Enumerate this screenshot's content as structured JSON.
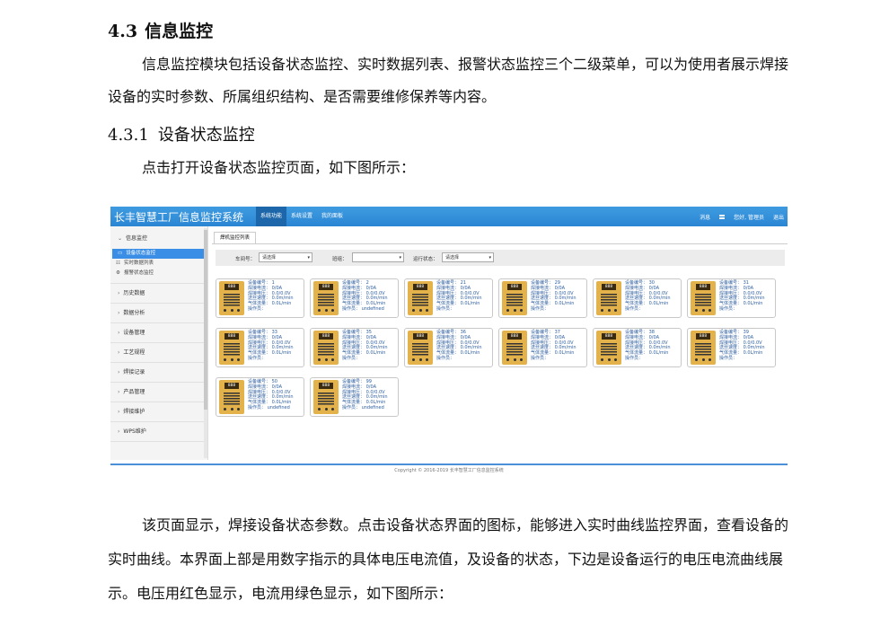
{
  "doc": {
    "section_number": "4.3",
    "section_title": "信息监控",
    "intro_paragraph": "信息监控模块包括设备状态监控、实时数据列表、报警状态监控三个二级菜单，可以为使用者展示焊接设备的实时参数、所属组织结构、是否需要维修保养等内容。",
    "subsection_number": "4.3.1",
    "subsection_title": "设备状态监控",
    "open_paragraph": "点击打开设备状态监控页面，如下图所示：",
    "closing_paragraph": "该页面显示，焊接设备状态参数。点击设备状态界面的图标，能够进入实时曲线监控界面，查看设备的实时曲线。本界面上部是用数字指示的具体电压电流值，及设备的状态，下边是设备运行的电压电流曲线展示。电压用红色显示，电流用绿色显示，如下图所示："
  },
  "app": {
    "title": "长丰智慧工厂信息监控系统",
    "nav": [
      "系统功能",
      "系统设置",
      "我的面板"
    ],
    "right": {
      "messages": "消息",
      "user": "您好, 管理员",
      "logout": "退出"
    },
    "sidebar": {
      "expanded": {
        "label": "信息监控",
        "items": [
          "设备状态监控",
          "实时数据列表",
          "报警状态监控"
        ]
      },
      "items": [
        "历史数据",
        "数据分析",
        "设备管理",
        "工艺规程",
        "焊接记录",
        "产品管理",
        "焊接维护",
        "WPS维护"
      ]
    },
    "tab": "焊机监控列表",
    "filters": {
      "workshop_label": "车间号：",
      "workshop_value": "请选择",
      "team_label": "班组：",
      "team_value": "",
      "status_label": "运行状态：",
      "status_value": "请选择"
    },
    "card_labels": {
      "id": "设备编号：",
      "current": "焊接电流：",
      "voltage": "焊接电压：",
      "speed": "送丝速度：",
      "gas": "气体流量：",
      "operator": "操作员："
    },
    "card_display": "888",
    "cards": [
      {
        "id": "1",
        "current": "0/0A",
        "voltage": "0.0/0.0V",
        "speed": "0.0m/min",
        "gas": "0.0L/min",
        "operator": ""
      },
      {
        "id": "2",
        "current": "0/0A",
        "voltage": "0.0/0.0V",
        "speed": "0.0m/min",
        "gas": "0.0L/min",
        "operator": "undefined"
      },
      {
        "id": "21",
        "current": "0/0A",
        "voltage": "0.0/0.0V",
        "speed": "0.0m/min",
        "gas": "0.0L/min",
        "operator": ""
      },
      {
        "id": "29",
        "current": "0/0A",
        "voltage": "0.0/0.0V",
        "speed": "0.0m/min",
        "gas": "0.0L/min",
        "operator": ""
      },
      {
        "id": "30",
        "current": "0/0A",
        "voltage": "0.0/0.0V",
        "speed": "0.0m/min",
        "gas": "0.0L/min",
        "operator": ""
      },
      {
        "id": "31",
        "current": "0/0A",
        "voltage": "0.0/0.0V",
        "speed": "0.0m/min",
        "gas": "0.0L/min",
        "operator": ""
      },
      {
        "id": "33",
        "current": "0/0A",
        "voltage": "0.0/0.0V",
        "speed": "0.0m/min",
        "gas": "0.0L/min",
        "operator": ""
      },
      {
        "id": "35",
        "current": "0/0A",
        "voltage": "0.0/0.0V",
        "speed": "0.0m/min",
        "gas": "0.0L/min",
        "operator": ""
      },
      {
        "id": "36",
        "current": "0/0A",
        "voltage": "0.0/0.0V",
        "speed": "0.0m/min",
        "gas": "0.0L/min",
        "operator": ""
      },
      {
        "id": "37",
        "current": "0/0A",
        "voltage": "0.0/0.0V",
        "speed": "0.0m/min",
        "gas": "0.0L/min",
        "operator": ""
      },
      {
        "id": "38",
        "current": "0/0A",
        "voltage": "0.0/0.0V",
        "speed": "0.0m/min",
        "gas": "0.0L/min",
        "operator": ""
      },
      {
        "id": "39",
        "current": "0/0A",
        "voltage": "0.0/0.0V",
        "speed": "0.0m/min",
        "gas": "0.0L/min",
        "operator": ""
      },
      {
        "id": "50",
        "current": "0/0A",
        "voltage": "0.0/0.0V",
        "speed": "0.0m/min",
        "gas": "0.0L/min",
        "operator": "undefined"
      },
      {
        "id": "99",
        "current": "0/0A",
        "voltage": "0.0/0.0V",
        "speed": "0.0m/min",
        "gas": "0.0L/min",
        "operator": "undefined"
      }
    ],
    "copyright": "Copyright © 2016-2019 长丰智慧工厂信息监控系统"
  }
}
